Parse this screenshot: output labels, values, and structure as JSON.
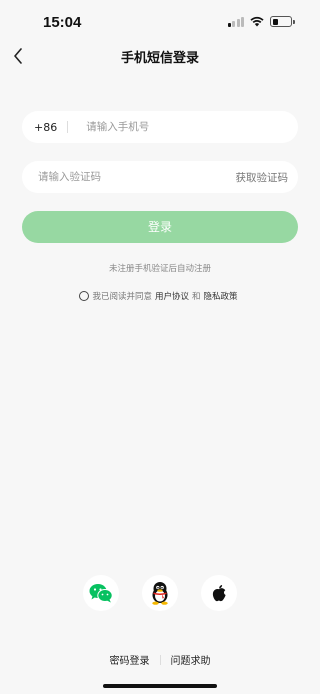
{
  "status_bar": {
    "time": "15:04",
    "signal_icon": "cellular-signal-icon",
    "wifi_icon": "wifi-icon",
    "battery_icon": "battery-icon",
    "battery_level": 0.35
  },
  "nav": {
    "back_icon": "chevron-left-icon",
    "title": "手机短信登录"
  },
  "phone": {
    "country_code": "+86",
    "placeholder": "请输入手机号",
    "value": ""
  },
  "code": {
    "placeholder": "请输入验证码",
    "value": "",
    "get_code_label": "获取验证码"
  },
  "login_button": {
    "label": "登录",
    "color": "#97d8a2"
  },
  "hint": "未注册手机验证后自动注册",
  "agreement": {
    "checked": false,
    "prefix": "我已阅读并同意",
    "user_agreement": "用户协议",
    "and": "和",
    "privacy_policy": "隐私政策"
  },
  "social": [
    {
      "icon": "wechat-icon",
      "color": "#07c160"
    },
    {
      "icon": "qq-icon",
      "color": "#111111"
    },
    {
      "icon": "apple-icon",
      "color": "#111111"
    }
  ],
  "footer": {
    "password_login": "密码登录",
    "help": "问题求助"
  }
}
